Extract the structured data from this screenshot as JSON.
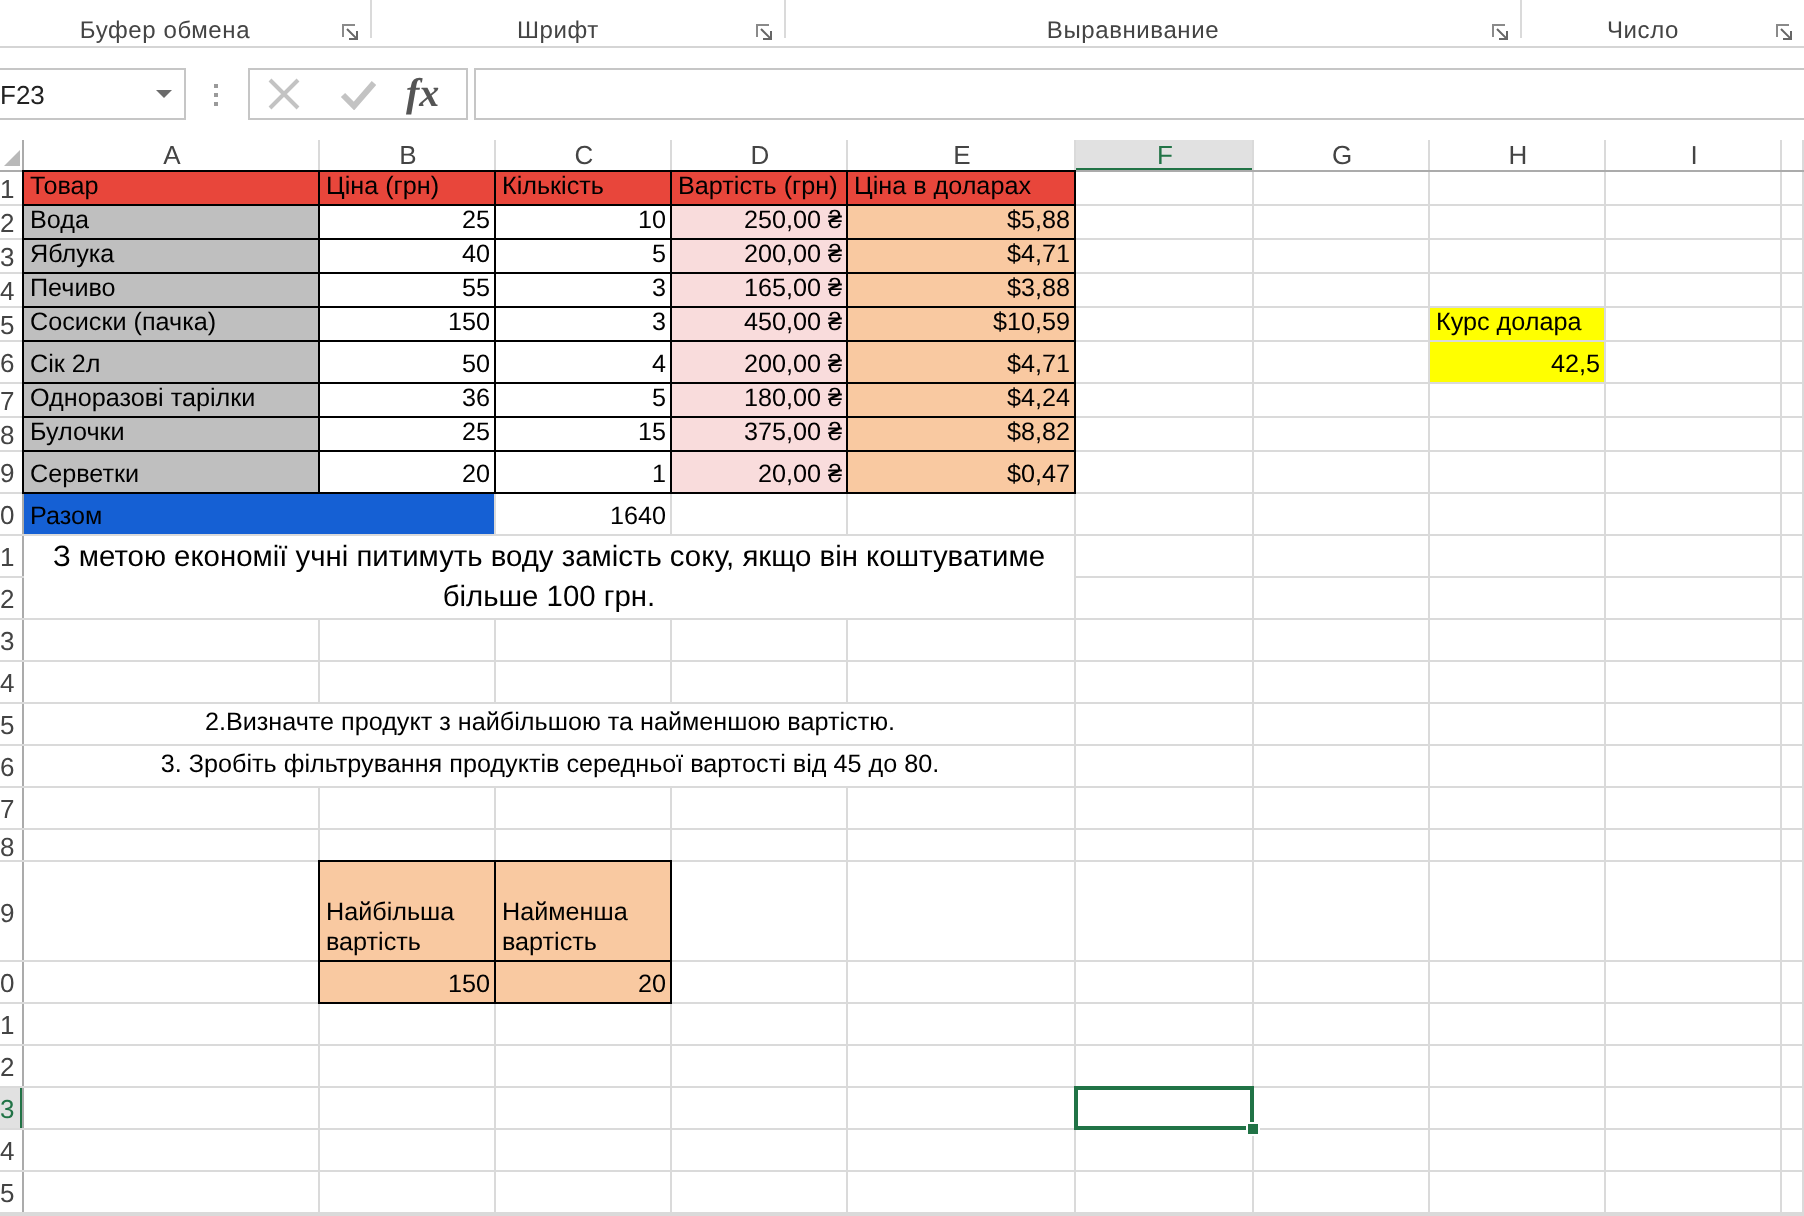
{
  "ribbon": {
    "groups": [
      {
        "label": "Буфер обмена"
      },
      {
        "label": "Шрифт"
      },
      {
        "label": "Выравнивание"
      },
      {
        "label": "Число"
      }
    ]
  },
  "formula_bar": {
    "name_box": "F23",
    "buttons": [
      {
        "kind": "cancel",
        "disabled": true
      },
      {
        "kind": "enter",
        "disabled": true
      },
      {
        "kind": "function",
        "label": "fx",
        "disabled": false
      }
    ]
  },
  "sheet": {
    "columns": [
      {
        "label": "A",
        "selected": false
      },
      {
        "label": "B",
        "selected": false
      },
      {
        "label": "C",
        "selected": false
      },
      {
        "label": "D",
        "selected": false
      },
      {
        "label": "E",
        "selected": false
      },
      {
        "label": "F",
        "selected": true
      },
      {
        "label": "G",
        "selected": false
      },
      {
        "label": "H",
        "selected": false
      },
      {
        "label": "I",
        "selected": false
      }
    ],
    "rows": [
      {
        "header": "1",
        "selected": false
      },
      {
        "header": "2",
        "selected": false
      },
      {
        "header": "3",
        "selected": false
      },
      {
        "header": "4",
        "selected": false
      },
      {
        "header": "5",
        "selected": false
      },
      {
        "header": "6",
        "selected": false
      },
      {
        "header": "7",
        "selected": false
      },
      {
        "header": "8",
        "selected": false
      },
      {
        "header": "9",
        "selected": false
      },
      {
        "header": "0",
        "selected": false
      },
      {
        "header": "1",
        "selected": false
      },
      {
        "header": "2",
        "selected": false
      },
      {
        "header": "3",
        "selected": false
      },
      {
        "header": "4",
        "selected": false
      },
      {
        "header": "5",
        "selected": false
      },
      {
        "header": "6",
        "selected": false
      },
      {
        "header": "7",
        "selected": false
      },
      {
        "header": "8",
        "selected": false
      },
      {
        "header": "9",
        "selected": false
      },
      {
        "header": "0",
        "selected": false
      },
      {
        "header": "1",
        "selected": false
      },
      {
        "header": "2",
        "selected": false
      },
      {
        "header": "3",
        "selected": true
      },
      {
        "header": "4",
        "selected": false
      },
      {
        "header": "5",
        "selected": false
      }
    ],
    "table": {
      "headers": [
        "Товар",
        "Ціна (грн)",
        "Кількість",
        "Вартість (грн)",
        "Ціна в доларах"
      ],
      "rows": [
        [
          "Вода",
          "25",
          "10",
          "250,00 ₴",
          "$5,88"
        ],
        [
          "Яблука",
          "40",
          "5",
          "200,00 ₴",
          "$4,71"
        ],
        [
          "Печиво",
          "55",
          "3",
          "165,00 ₴",
          "$3,88"
        ],
        [
          "Сосиски (пачка)",
          "150",
          "3",
          "450,00 ₴",
          "$10,59"
        ],
        [
          "Сік 2л",
          "50",
          "4",
          "200,00 ₴",
          "$4,71"
        ],
        [
          "Одноразові тарілки",
          "36",
          "5",
          "180,00 ₴",
          "$4,24"
        ],
        [
          "Булочки",
          "25",
          "15",
          "375,00 ₴",
          "$8,82"
        ],
        [
          "Серветки",
          "20",
          "1",
          "20,00 ₴",
          "$0,47"
        ]
      ],
      "total": {
        "label": "Разом",
        "value": "1640"
      }
    },
    "exchange_rate": {
      "label": "Курс долара",
      "value": "42,5"
    },
    "note": "З метою економії учні питимуть воду замість соку, якщо він коштуватиме більше 100 грн.",
    "tasks": [
      "2.Визначте продукт з найбільшою та найменшою вартістю.",
      "3. Зробіть фільтрування продуктів середньої вартості від 45 до 80."
    ],
    "summary": {
      "headers": [
        "Найбільша вартість",
        "Найменша вартість"
      ],
      "values": [
        "150",
        "20"
      ]
    }
  }
}
